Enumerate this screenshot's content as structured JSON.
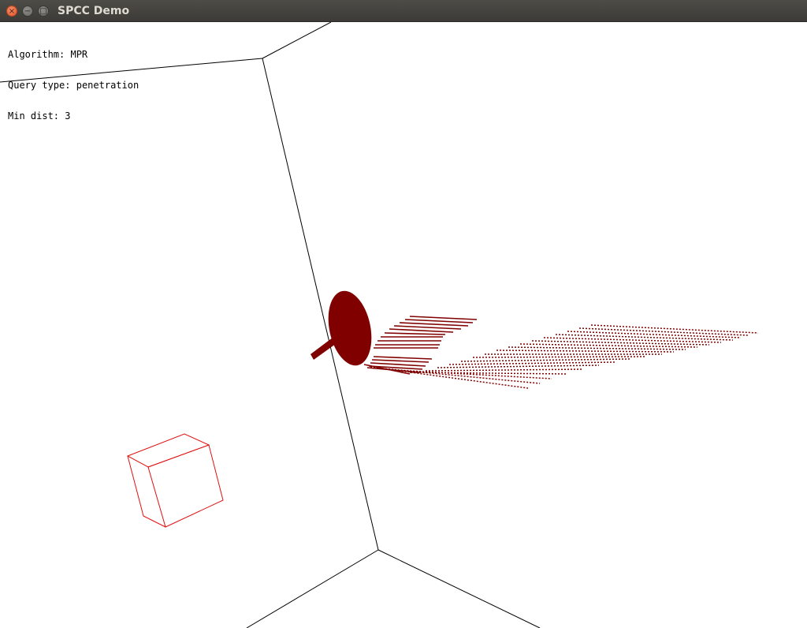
{
  "window": {
    "title": "SPCC Demo",
    "close_glyph": "×",
    "minimize_glyph": "−",
    "maximize_glyph": "□"
  },
  "hud": {
    "algorithm_label": "Algorithm:",
    "algorithm_value": "MPR",
    "query_label": "Query type:",
    "query_value": "penetration",
    "min_dist_label": "Min dist:",
    "min_dist_value": "3"
  },
  "colors": {
    "background": "#ffffff",
    "edges": "#000000",
    "point_cloud": "#800000",
    "cube_wireframe": "#e01010"
  },
  "icons": {
    "close": "close-icon",
    "minimize": "minimize-icon",
    "maximize": "maximize-icon"
  }
}
